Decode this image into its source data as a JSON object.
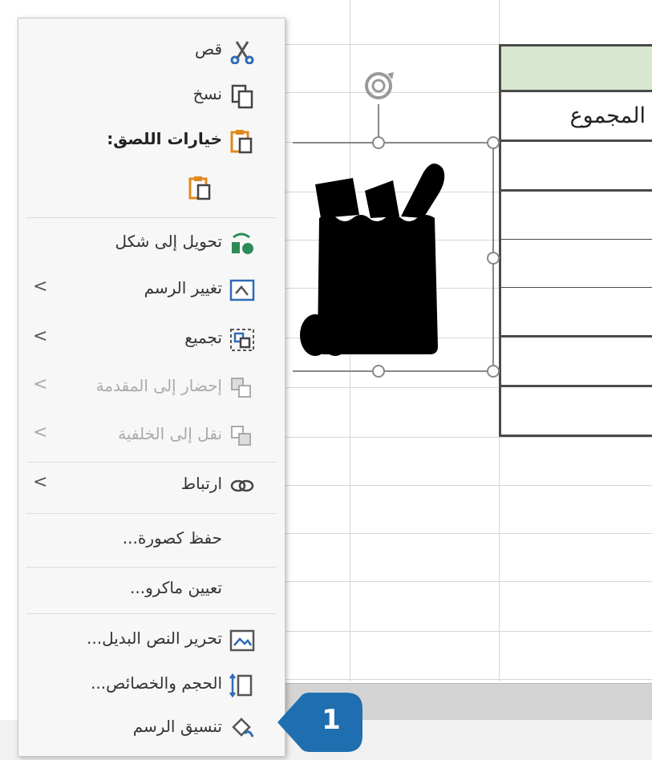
{
  "sheet": {
    "column_header": "المجموع",
    "header_fill": "#d8e7cf"
  },
  "context_menu": {
    "items": [
      {
        "label": "قص",
        "icon": "scissors-icon"
      },
      {
        "label": "نسخ",
        "icon": "copy-icon"
      },
      {
        "label": "خيارات اللصق:",
        "icon": "paste-options-icon"
      },
      {
        "label": "",
        "icon": "paste-icon"
      },
      {
        "label": "تحويل إلى شكل",
        "icon": "convert-to-shape-icon"
      },
      {
        "label": "تغيير الرسم",
        "icon": "change-graphic-icon",
        "arrow": "<"
      },
      {
        "label": "تجميع",
        "icon": "group-icon",
        "arrow": "<"
      },
      {
        "label": "إحضار إلى المقدمة",
        "icon": "bring-forward-icon",
        "arrow": "<"
      },
      {
        "label": "نقل إلى الخلفية",
        "icon": "send-backward-icon",
        "arrow": "<"
      },
      {
        "label": "ارتباط",
        "icon": "link-icon",
        "arrow": "<"
      },
      {
        "label": "حفظ كصورة..."
      },
      {
        "label": "تعيين ماكرو..."
      },
      {
        "label": "تحرير النص البديل...",
        "icon": "alt-text-icon"
      },
      {
        "label": "الحجم والخصائص...",
        "icon": "size-properties-icon"
      },
      {
        "label": "تنسيق الرسم",
        "icon": "format-graphic-icon"
      }
    ]
  },
  "callout": {
    "number": "1",
    "color": "#1f6fb0"
  }
}
